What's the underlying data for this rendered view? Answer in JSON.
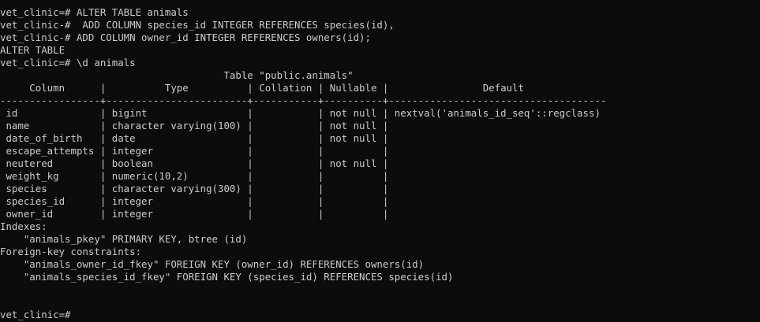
{
  "terminal": {
    "background": "#0c0c0c",
    "foreground": "#cccccc",
    "lines": [
      "vet_clinic=# ALTER TABLE animals",
      "vet_clinic-#  ADD COLUMN species_id INTEGER REFERENCES species(id),",
      "vet_clinic-# ADD COLUMN owner_id INTEGER REFERENCES owners(id);",
      "ALTER TABLE",
      "vet_clinic=# \\d animals",
      "                                      Table \"public.animals\"",
      "     Column      |          Type          | Collation | Nullable |                Default",
      "-----------------+------------------------+-----------+----------+-------------------------------------",
      " id              | bigint                 |           | not null | nextval('animals_id_seq'::regclass)",
      " name            | character varying(100) |           | not null |",
      " date_of_birth   | date                   |           | not null |",
      " escape_attempts | integer                |           |          |",
      " neutered        | boolean                |           | not null |",
      " weight_kg       | numeric(10,2)          |           |          |",
      " species         | character varying(300) |           |          |",
      " species_id      | integer                |           |          |",
      " owner_id        | integer                |           |          |",
      "Indexes:",
      "    \"animals_pkey\" PRIMARY KEY, btree (id)",
      "Foreign-key constraints:",
      "    \"animals_owner_id_fkey\" FOREIGN KEY (owner_id) REFERENCES owners(id)",
      "    \"animals_species_id_fkey\" FOREIGN KEY (species_id) REFERENCES species(id)",
      "",
      "",
      "vet_clinic=#"
    ]
  }
}
